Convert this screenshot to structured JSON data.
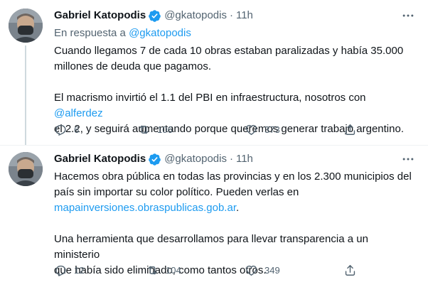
{
  "tweets": [
    {
      "author": "Gabriel Katopodis",
      "handle": "@gkatopodis",
      "time": "11h",
      "reply_prefix": "En respuesta a",
      "reply_handle": "@gkatopodis",
      "line1": "Cuando llegamos 7 de cada 10 obras estaban paralizadas y había 35.000",
      "line2": "millones de deuda que pagamos.",
      "line3_a": "El macrismo invirtió el 1.1 del PBI en infraestructura, nosotros con ",
      "line3_link": "@alferdez",
      "line4": "el 2.2, y seguirá aumentando porque queremos generar trabajo argentino.",
      "replies": "6",
      "retweets": "106",
      "likes": "373"
    },
    {
      "author": "Gabriel Katopodis",
      "handle": "@gkatopodis",
      "time": "11h",
      "line1": "Hacemos obra pública en todas las provincias y en los 2.300 municipios del",
      "line2": "país sin importar su color político. Pueden verlas en",
      "line3_link": "mapainversiones.obraspublicas.gob.ar",
      "line3_end": ".",
      "line4": "Una herramienta que desarrollamos para llevar transparencia a un ministerio",
      "line5": "que había sido eliminado, como tantos otros.",
      "replies": "12",
      "retweets": "104",
      "likes": "349"
    }
  ],
  "icons": {
    "verified": "verified-badge-icon",
    "more": "more-icon",
    "reply": "reply-icon",
    "retweet": "retweet-icon",
    "like": "like-icon",
    "share": "share-icon"
  },
  "colors": {
    "text": "#0f1419",
    "secondary": "#536471",
    "link": "#1d9bf0",
    "verified": "#1d9bf0",
    "divider": "#eff3f4"
  }
}
